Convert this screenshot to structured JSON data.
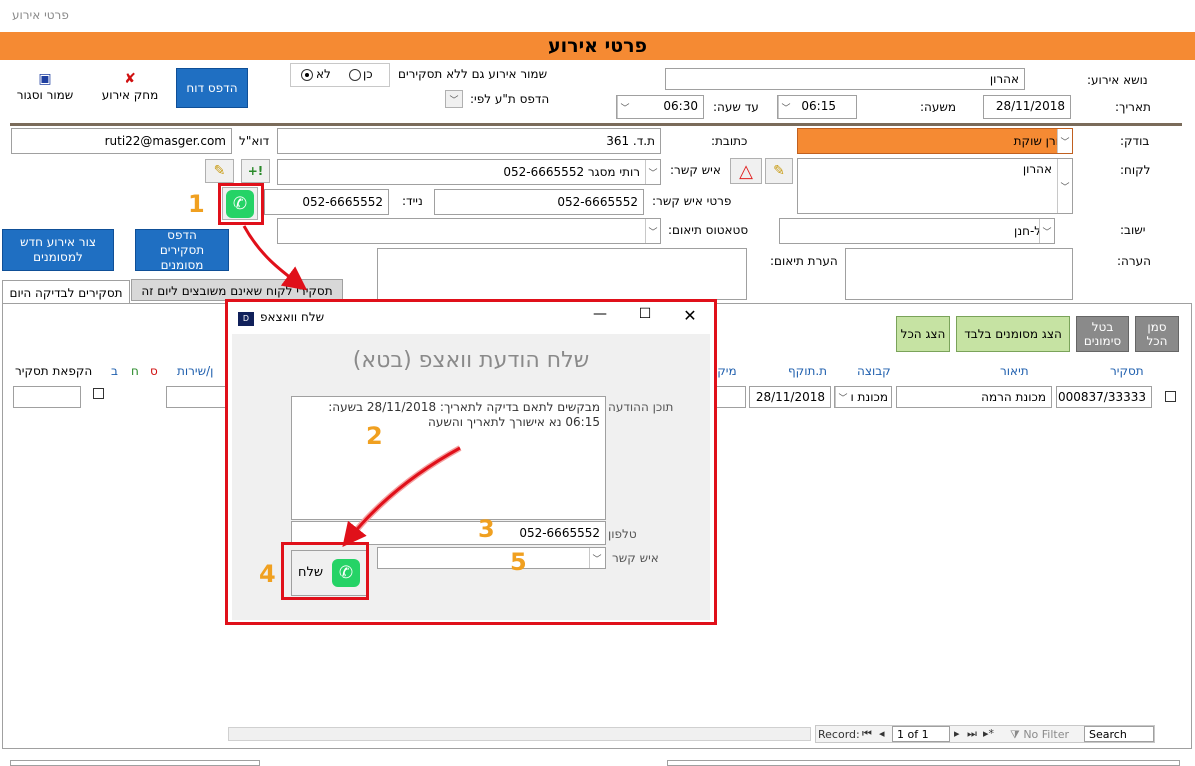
{
  "window": {
    "title": "פרטי אירוע"
  },
  "header": {
    "title": "פרטי אירוע",
    "color": "#f58a33"
  },
  "toolbar": {
    "save_close": "שמור וסגור",
    "delete_event": "מחק אירוע",
    "print_report": "הדפס דוח"
  },
  "options": {
    "save_without_reports_label": "שמור אירוע גם ללא תסקירים",
    "yes": "כן",
    "no": "לא",
    "print_by_label": "הדפס ת\"ע לפי:"
  },
  "form": {
    "subject_label": "נושא אירוע:",
    "subject_value": "אהרון",
    "date_label": "תאריך:",
    "date_value": "28/11/2018",
    "from_time_label": "משעה:",
    "from_time_value": "06:15",
    "to_time_label": "עד שעה:",
    "to_time_value": "06:30",
    "inspector_label": "בודק:",
    "inspector_value": "אורן שוקת",
    "address_label": "כתובת:",
    "address_value": "ת.ד. 361",
    "email_label": "דוא\"ל",
    "email_value": "ruti22@masger.com",
    "customer_label": "לקוח:",
    "customer_value": "אהרון",
    "contact_label": "איש קשר:",
    "contact_value": "רותי מסגר  052-6665552",
    "contact_details_label": "פרטי איש קשר:",
    "contact_details_value": "052-6665552",
    "mobile_label": "נייד:",
    "mobile_value": "052-6665552",
    "city_label": "ישוב:",
    "city_value": "תל-חנן",
    "coord_status_label": "סטאטוס תיאום:",
    "coord_status_value": "",
    "note_label": "הערה:",
    "coord_note_label": "הערת תיאום:"
  },
  "side_buttons": {
    "print_marked": "הדפס תסקירים מסומנים",
    "new_event_marked": "צור אירוע חדש למסומנים"
  },
  "tabs": {
    "today": "תסקירים לבדיקה היום",
    "not_assigned": "תסקירי לקוח שאינם משובצים ליום זה"
  },
  "grid_buttons": {
    "mark_all": "סמן הכל",
    "cancel_marks": "בטל סימונים",
    "show_marked_only": "הצג מסומנים בלבד",
    "show_all": "הצג הכל"
  },
  "columns": {
    "report": "תסקיר",
    "description": "תיאור",
    "group": "קבוצה",
    "valid_until": "ת.תוקף",
    "location": "מיקו",
    "service": "ן/שירות",
    "letters": [
      "ב",
      "ח",
      "ס"
    ],
    "freeze": "הקפאת תסקיר"
  },
  "row": {
    "report": "000837/33333",
    "description": "מכונת הרמה",
    "group": "מכונת ו",
    "valid_until": "28/11/2018"
  },
  "record_nav": {
    "record_label": "Record:",
    "position": "1 of 1",
    "no_filter": "No Filter",
    "search": "Search"
  },
  "dialog": {
    "title": "שלח וואצאפ",
    "heading": "שלח הודעת וואצפ (בטא)",
    "message_label": "תוכן ההודעה",
    "message_line1": "מבקשים לתאם בדיקה לתאריך: 28/11/2018 בשעה:",
    "message_line2": "06:15  נא אישורך לתאריך והשעה",
    "phone_label": "טלפון",
    "phone_value": "052-6665552",
    "contact_label": "איש קשר",
    "send_label": "שלח"
  },
  "annotations": [
    "1",
    "2",
    "3",
    "4",
    "5"
  ]
}
